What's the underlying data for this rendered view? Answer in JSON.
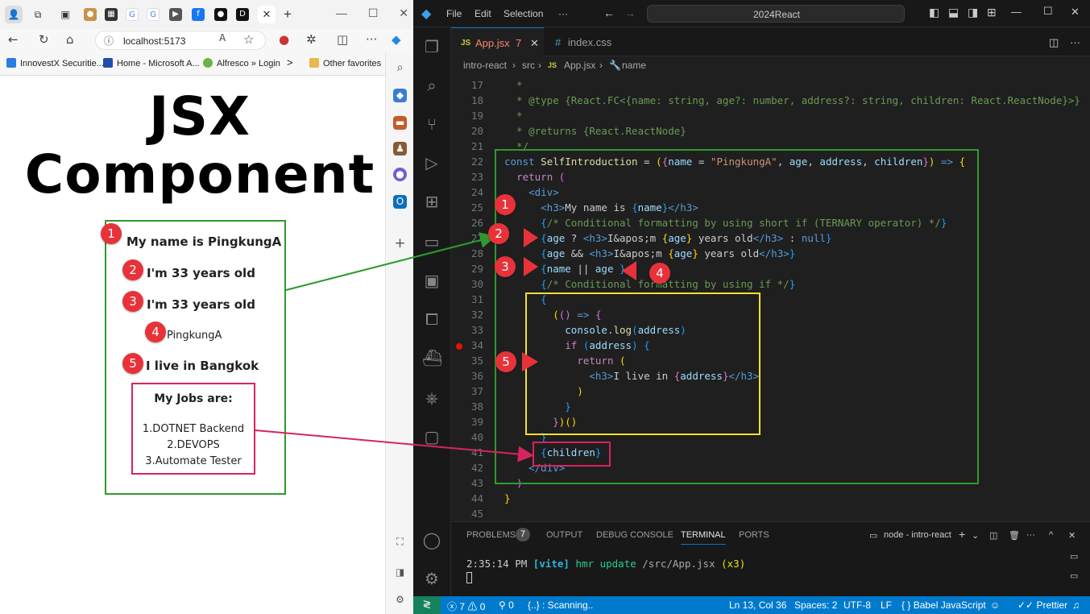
{
  "browser": {
    "address": "localhost:5173",
    "favorites": [
      "InnovestX Securitie...",
      "Home - Microsoft A...",
      "Alfresco » Login",
      "Other favorites"
    ],
    "page": {
      "title_line1": "JSX",
      "title_line2": "Component",
      "outputs": [
        "My name is PingkungA",
        "I'm 33 years old",
        "I'm 33 years old",
        "PingkungA",
        "I live in Bangkok"
      ],
      "jobs_title": "My Jobs are:",
      "jobs": [
        "1.DOTNET Backend",
        "2.DEVOPS",
        "3.Automate Tester"
      ]
    }
  },
  "vscode": {
    "menu": [
      "File",
      "Edit",
      "Selection",
      "···"
    ],
    "search": "2024React",
    "tabs": [
      {
        "label": "App.jsx",
        "badge": "7",
        "prefix": "JS"
      },
      {
        "label": "index.css",
        "prefix": "#"
      }
    ],
    "breadcrumb": [
      "intro-react",
      "src",
      "App.jsx",
      "name"
    ],
    "line_numbers": [
      "17",
      "18",
      "19",
      "20",
      "21",
      "22",
      "23",
      "24",
      "25",
      "26",
      "27",
      "28",
      "29",
      "30",
      "31",
      "32",
      "33",
      "34",
      "35",
      "36",
      "37",
      "38",
      "39",
      "40",
      "41",
      "42",
      "43",
      "44",
      "45"
    ],
    "panel_tabs": {
      "problems": "PROBLEMS",
      "problems_count": "7",
      "output": "OUTPUT",
      "debug": "DEBUG CONSOLE",
      "terminal": "TERMINAL",
      "ports": "PORTS",
      "terminal_name": "node - intro-react"
    },
    "terminal_time": "2:35:14 PM",
    "terminal_tag": "[vite]",
    "terminal_msg": "hmr update",
    "terminal_path": "/src/App.jsx",
    "terminal_count": "(x3)",
    "status": {
      "errors": "7",
      "warnings": "0",
      "ports": "0",
      "scan": "{..} : Scanning..",
      "position": "Ln 13, Col 36",
      "spaces": "Spaces: 2",
      "encoding": "UTF-8",
      "eol": "LF",
      "language": "Babel JavaScript",
      "formatter": "Prettier"
    }
  },
  "annotations": [
    "1",
    "2",
    "3",
    "4",
    "5"
  ],
  "colors": {
    "green_box": "#2e9a2e",
    "yellow_box": "#f0e030",
    "pink_box": "#d6245f",
    "badge": "#e8323a",
    "status_bar": "#007acc"
  }
}
